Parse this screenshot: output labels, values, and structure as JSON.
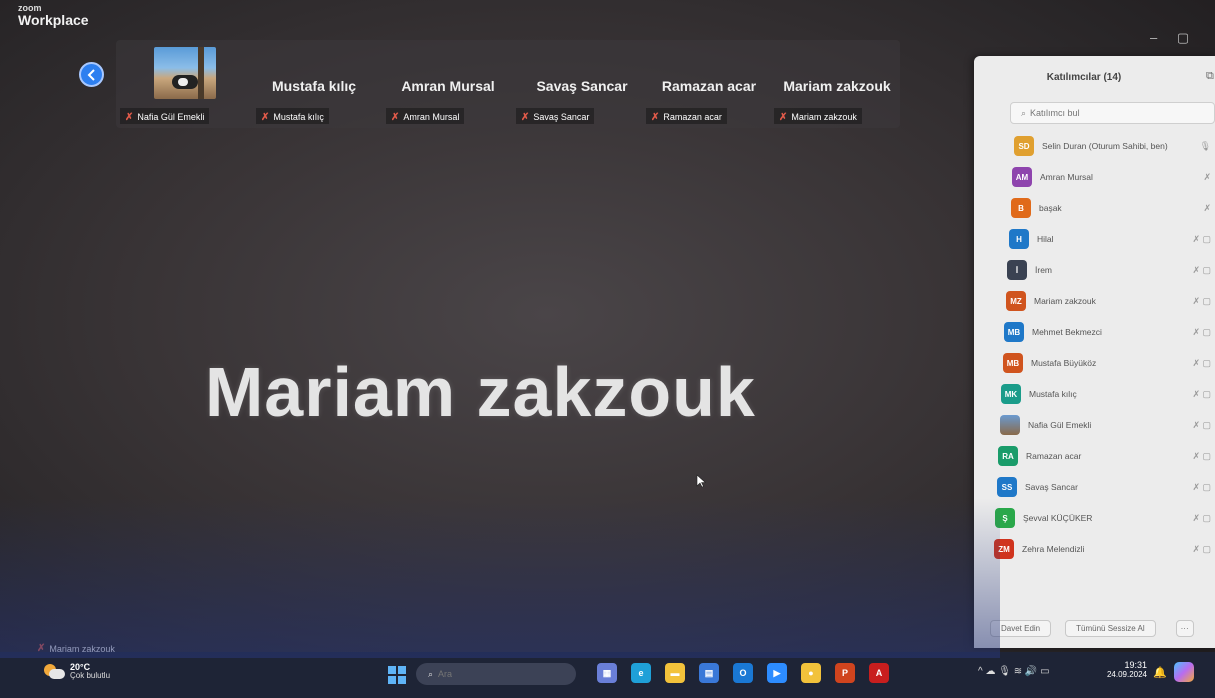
{
  "app": {
    "brand_small": "zoom",
    "brand_big": "Workplace"
  },
  "window_controls": {
    "minimize": "–",
    "restore": "▢"
  },
  "strip": {
    "tiles": [
      {
        "name": "",
        "label": "Nafia Gül Emekli",
        "has_photo": true
      },
      {
        "name": "Mustafa kılıç",
        "label": "Mustafa kılıç"
      },
      {
        "name": "Amran Mursal",
        "label": "Amran Mursal"
      },
      {
        "name": "Savaş Sancar",
        "label": "Savaş Sancar"
      },
      {
        "name": "Ramazan acar",
        "label": "Ramazan acar"
      },
      {
        "name": "Mariam zakzouk",
        "label": "Mariam zakzouk"
      }
    ]
  },
  "main": {
    "active_speaker_name": "Mariam zakzouk",
    "bottom_label": "Mariam zakzouk"
  },
  "participants_panel": {
    "title": "Katılımcılar (14)",
    "search_placeholder": "Katılımcı bul",
    "participants": [
      {
        "initials": "SD",
        "name": "Selin Duran (Oturum Sahibi, ben)",
        "color": "#e0a030",
        "icons": "🎙"
      },
      {
        "initials": "AM",
        "name": "Amran Mursal",
        "color": "#8e44ad",
        "icons": "✗"
      },
      {
        "initials": "B",
        "name": "başak",
        "color": "#e06a1a",
        "icons": "✗"
      },
      {
        "initials": "H",
        "name": "Hilal",
        "color": "#1f78c8",
        "icons": "✗ ▢"
      },
      {
        "initials": "İ",
        "name": "İrem",
        "color": "#3a4252",
        "icons": "✗ ▢"
      },
      {
        "initials": "MZ",
        "name": "Mariam zakzouk",
        "color": "#d0541e",
        "icons": "✗ ▢"
      },
      {
        "initials": "MB",
        "name": "Mehmet Bekmezci",
        "color": "#1f78c8",
        "icons": "✗ ▢"
      },
      {
        "initials": "MB",
        "name": "Mustafa Büyüköz",
        "color": "#d0541e",
        "icons": "✗ ▢"
      },
      {
        "initials": "MK",
        "name": "Mustafa kılıç",
        "color": "#1a9c8a",
        "icons": "✗ ▢"
      },
      {
        "initials": "",
        "name": "Nafia Gül Emekli",
        "color": "#3a3a3a",
        "icons": "✗ ▢",
        "photo": true
      },
      {
        "initials": "RA",
        "name": "Ramazan acar",
        "color": "#1a9c6a",
        "icons": "✗ ▢"
      },
      {
        "initials": "SS",
        "name": "Savaş Sancar",
        "color": "#1f78c8",
        "icons": "✗ ▢"
      },
      {
        "initials": "Ş",
        "name": "Şevval KÜÇÜKER",
        "color": "#2aa84a",
        "icons": "✗ ▢"
      },
      {
        "initials": "ZM",
        "name": "Zehra Melendizli",
        "color": "#d0341e",
        "icons": "✗ ▢"
      }
    ],
    "invite_button": "Davet Edin",
    "mute_all_button": "Tümünü Sessize Al",
    "more_button": "···"
  },
  "taskbar": {
    "weather_temp": "20°C",
    "weather_desc": "Çok bulutlu",
    "search_placeholder": "Ara",
    "tray_icons": "^ ☁ 🎙 ≋ 🔊 ▭",
    "time": "19:31",
    "date": "24.09.2024",
    "apps": [
      {
        "icon": "widgets-icon",
        "color": "#6a7fd8",
        "glyph": "▦"
      },
      {
        "icon": "edge-icon",
        "color": "#1fa0d8",
        "glyph": "e"
      },
      {
        "icon": "explorer-icon",
        "color": "#f2c23b",
        "glyph": "▬"
      },
      {
        "icon": "store-icon",
        "color": "#3a78d8",
        "glyph": "▤"
      },
      {
        "icon": "outlook-icon",
        "color": "#1a78d4",
        "glyph": "O"
      },
      {
        "icon": "zoom-icon",
        "color": "#2d8cff",
        "glyph": "▶"
      },
      {
        "icon": "chrome-icon",
        "color": "#f2c23b",
        "glyph": "●"
      },
      {
        "icon": "powerpoint-icon",
        "color": "#d0441e",
        "glyph": "P"
      },
      {
        "icon": "acrobat-icon",
        "color": "#c81e1e",
        "glyph": "A"
      }
    ]
  }
}
